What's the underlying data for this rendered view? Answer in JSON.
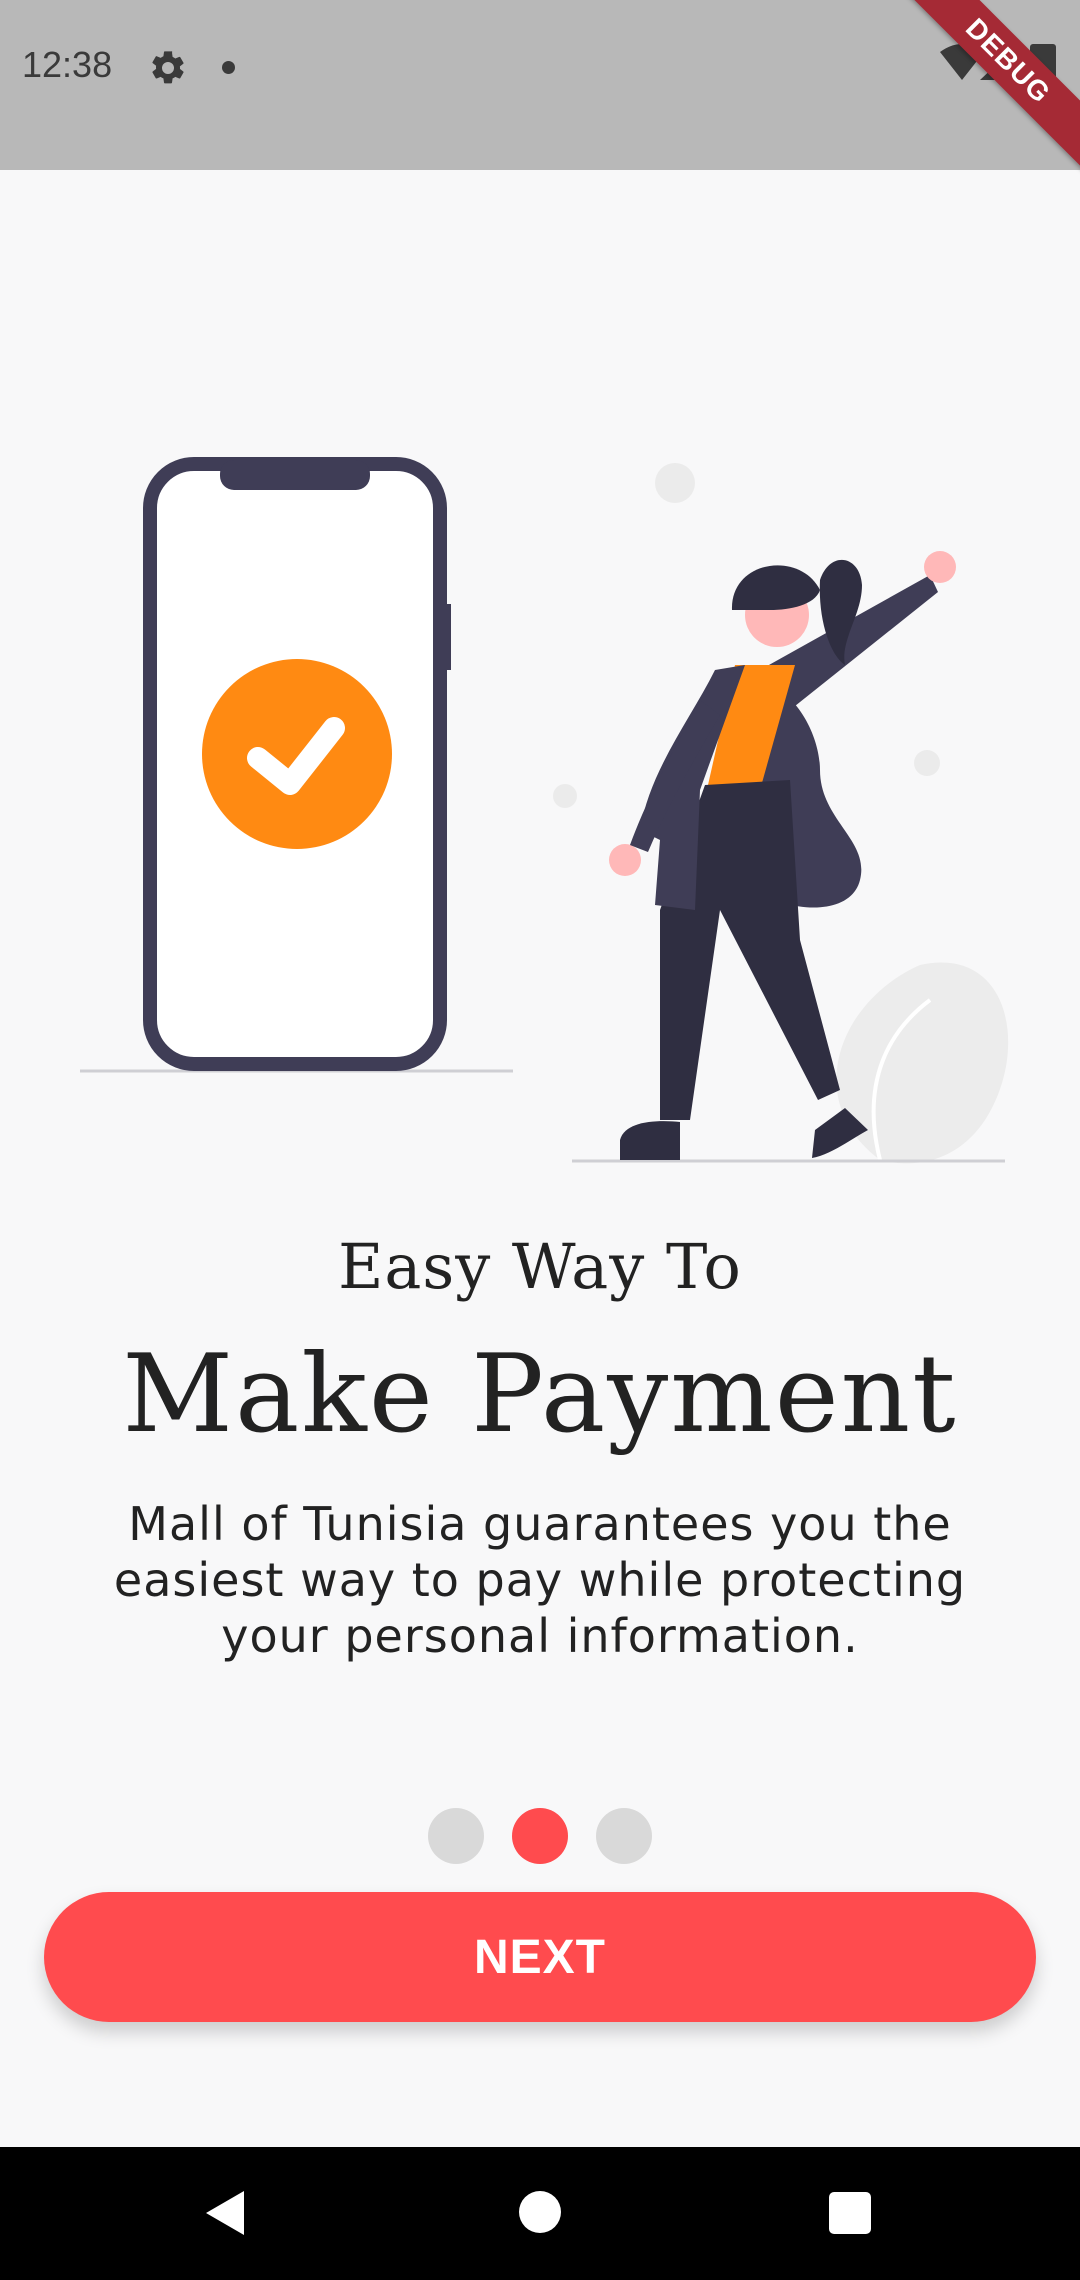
{
  "status_bar": {
    "time": "12:38",
    "debug_label": "DEBUG",
    "background": "#b8b8b8"
  },
  "onboarding": {
    "subtitle": "Easy Way To",
    "title": "Make Payment",
    "description": "Mall of Tunisia guarantees you the easiest way to pay while protecting your personal information.",
    "page_indicator": {
      "total": 3,
      "active_index": 1
    },
    "next_button_label": "NEXT"
  },
  "colors": {
    "accent": "#ff4b4e",
    "check_orange": "#ff8a12",
    "figure_dark": "#3f3d56",
    "background": "#f8f8f9"
  },
  "icons": {
    "status": [
      "gear-icon",
      "notification-dot-icon",
      "wifi-icon",
      "signal-icon",
      "battery-icon"
    ],
    "nav": [
      "back-icon",
      "home-icon",
      "recents-icon"
    ],
    "illustration": [
      "phone-icon",
      "check-icon",
      "woman-figure"
    ]
  }
}
